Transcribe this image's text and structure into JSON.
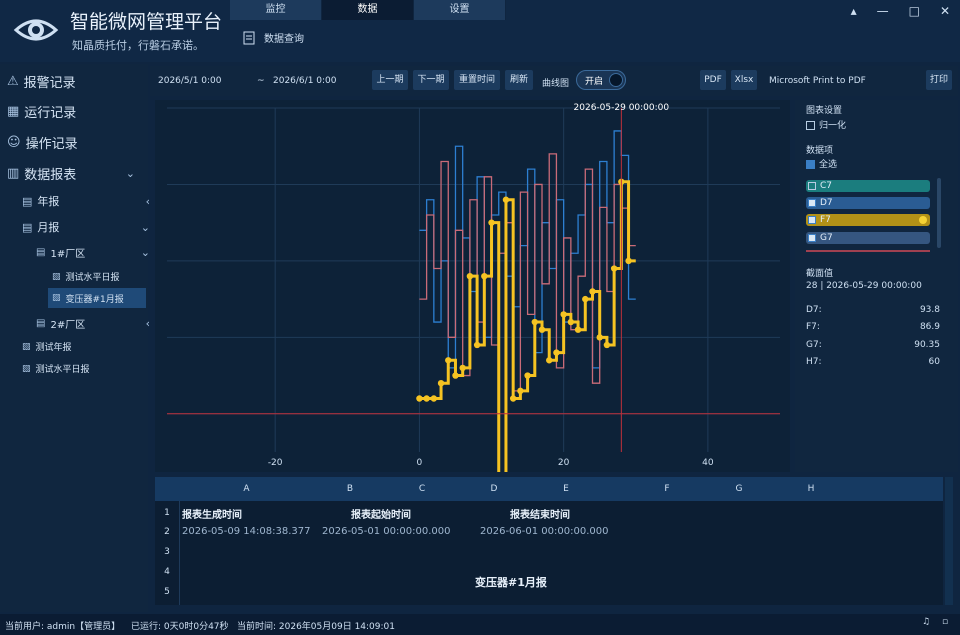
{
  "app": {
    "title": "智能微网管理平台",
    "subtitle": "知晶质托付，行磐石承诺。"
  },
  "tabs": [
    {
      "label": "监控"
    },
    {
      "label": "数据"
    },
    {
      "label": "设置"
    }
  ],
  "subnav": {
    "label": "数据查询"
  },
  "sidebar": {
    "alarm": "报警记录",
    "run": "运行记录",
    "op": "操作记录",
    "report": "数据报表",
    "year": "年报",
    "month": "月报",
    "factory1": "1#厂区",
    "test_water": "测试水平日报",
    "transformer": "变压器#1月报",
    "factory2": "2#厂区",
    "test_year": "测试年报",
    "test_daily": "测试水平日报"
  },
  "toolbar": {
    "start": "2026/5/1 0:00",
    "sep": "~",
    "end": "2026/6/1 0:00",
    "prev": "上一期",
    "next": "下一期",
    "reset": "重置时间",
    "refresh": "刷新",
    "curve_label": "曲线图",
    "toggle": "开启",
    "pdf": "PDF",
    "xlsx": "Xlsx",
    "printer": "Microsoft Print to PDF",
    "print": "打印"
  },
  "chart_data": {
    "type": "line",
    "cursor_label": "2026-05-29 00:00:00",
    "x_ticks": [
      "-20",
      "0",
      "20",
      "40"
    ],
    "xlim": [
      -35,
      50
    ],
    "ylim": [
      55,
      100
    ],
    "hline": 60,
    "cursor_x": 28,
    "series": [
      {
        "name": "D7",
        "color": "#2d7fd1",
        "values": [
          84,
          88,
          72,
          80,
          66,
          95,
          83,
          76,
          91,
          70,
          86,
          89,
          78,
          74,
          82,
          92,
          68,
          85,
          79,
          88,
          72,
          81,
          86,
          90,
          66,
          93,
          85,
          97,
          93.8,
          75
        ]
      },
      {
        "name": "F7",
        "color": "#c96b78",
        "values": [
          75,
          86,
          79,
          93,
          70,
          84,
          65,
          88,
          72,
          91,
          69,
          81,
          85,
          63,
          89,
          73,
          90,
          77,
          94,
          66,
          83,
          71,
          78,
          92,
          64,
          87,
          76,
          90,
          86.9,
          82
        ]
      },
      {
        "name": "G7",
        "color": "#f5c322",
        "values": [
          62,
          62,
          62,
          64,
          67,
          65,
          66,
          78,
          69,
          78,
          85,
          52,
          88,
          62,
          63,
          65,
          72,
          71,
          67,
          68,
          73,
          72,
          71,
          75,
          76,
          70,
          69,
          79,
          90.35,
          80
        ]
      }
    ]
  },
  "right_panel": {
    "chart_settings": "图表设置",
    "normalize": "归一化",
    "data_items": "数据项",
    "select_all": "全选",
    "series_items": [
      {
        "name": "C7",
        "color": "#1b8a8a"
      },
      {
        "name": "D7",
        "color": "#2b5f98"
      },
      {
        "name": "F7",
        "color": "#b8951c"
      },
      {
        "name": "G7",
        "color": "#3a5a82"
      }
    ],
    "section_label": "截面值",
    "section_value": "28 | 2026-05-29 00:00:00",
    "values": [
      {
        "k": "D7:",
        "v": "93.8"
      },
      {
        "k": "F7:",
        "v": "86.9"
      },
      {
        "k": "G7:",
        "v": "90.35"
      },
      {
        "k": "H7:",
        "v": "60"
      }
    ]
  },
  "sheet": {
    "columns": [
      "A",
      "B",
      "C",
      "D",
      "E",
      "F",
      "G",
      "H"
    ],
    "rows": [
      "1",
      "2",
      "3",
      "4",
      "5"
    ],
    "r1": {
      "gen": "报表生成时间",
      "start": "报表起始时间",
      "end": "报表结束时间"
    },
    "r2": {
      "gen": "2026-05-09 14:08:38.377",
      "start": "2026-05-01 00:00:00.000",
      "end": "2026-06-01 00:00:00.000"
    },
    "title": "变压器#1月报"
  },
  "status": {
    "user": "当前用户: admin【管理员】",
    "running": "已运行: 0天0时0分47秒",
    "time": "当前时间: 2026年05月09日 14:09:01"
  }
}
